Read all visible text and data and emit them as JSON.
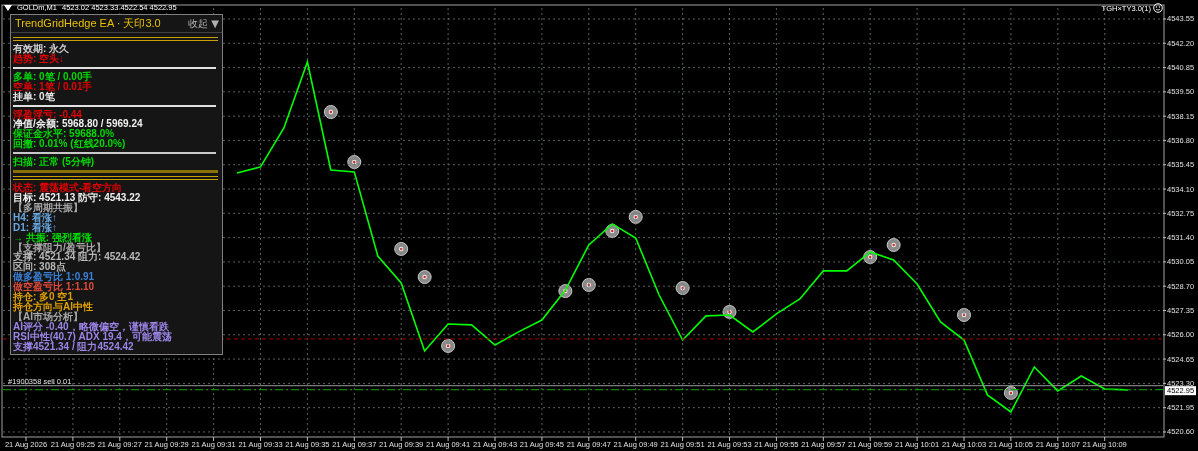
{
  "header": {
    "symbol": "GOLDm,M1",
    "quote": "4523.02 4523.33 4522.54 4522.95",
    "expert": "TGH×TY3.0(1)"
  },
  "panel": {
    "title": "TrendGridHedge EA · 天印3.0",
    "collapse_button": "收起 ▼",
    "lines": [
      {
        "kind": "double_rule",
        "color": "#c8a000"
      },
      {
        "kind": "text",
        "text": "有效期: 永久",
        "color": "#d0d0d0"
      },
      {
        "kind": "text",
        "text": "趋势: 空头↓",
        "color": "#e00000"
      },
      {
        "kind": "rule",
        "color": "#e0e0e0"
      },
      {
        "kind": "text",
        "text": "多单: 0笔 / 0.00手",
        "color": "#00d800"
      },
      {
        "kind": "text",
        "text": "空单: 1笔 / 0.01手",
        "color": "#e00000"
      },
      {
        "kind": "text",
        "text": "挂单: 0笔",
        "color": "#e8e8e8"
      },
      {
        "kind": "rule",
        "color": "#e0e0e0"
      },
      {
        "kind": "text",
        "text": "浮盈浮亏: -0.44",
        "color": "#e00000"
      },
      {
        "kind": "text",
        "text": "净值/余额: 5968.80 / 5969.24",
        "color": "#f0f0f0"
      },
      {
        "kind": "text",
        "text": "保证金水平: 59688.0%",
        "color": "#00d800"
      },
      {
        "kind": "text",
        "text": "回撤: 0.01% (红线20.0%)",
        "color": "#00d800"
      },
      {
        "kind": "rule",
        "color": "#c8c8c8"
      },
      {
        "kind": "text",
        "text": "扫描: 正常 (5分钟)",
        "color": "#00d800"
      },
      {
        "kind": "thick_rule",
        "color": "#8a7000"
      },
      {
        "kind": "double_rule",
        "color": "#c8a000"
      },
      {
        "kind": "text",
        "text": "状态: 震荡模式-看空方向",
        "color": "#e00000"
      },
      {
        "kind": "text",
        "text": "目标: 4521.13  防守: 4543.22",
        "color": "#f0f0f0"
      },
      {
        "kind": "text",
        "text": "【多周期共振】",
        "color": "#a8a8a8"
      },
      {
        "kind": "text",
        "text": "H4: 看涨↑",
        "color": "#68a8e0"
      },
      {
        "kind": "text",
        "text": "D1: 看涨↑",
        "color": "#68a8e0"
      },
      {
        "kind": "text",
        "text": "→ 共振: 强烈看涨",
        "color": "#00e000"
      },
      {
        "kind": "text",
        "text": "【支撑阻力/盈亏比】",
        "color": "#a8a8a8"
      },
      {
        "kind": "text",
        "text": "支撑: 4521.34  阻力: 4524.42",
        "color": "#b8b8b8"
      },
      {
        "kind": "text",
        "text": "区间: 308点",
        "color": "#b8b8b8"
      },
      {
        "kind": "text",
        "text": "做多盈亏比 1:0.91",
        "color": "#3a80d8"
      },
      {
        "kind": "text",
        "text": "做空盈亏比 1:1.10",
        "color": "#e04a3a"
      },
      {
        "kind": "text",
        "text": "持仓: 多0 空1",
        "color": "#e0a000"
      },
      {
        "kind": "text",
        "text": "持仓方向与AI中性",
        "color": "#e0a000"
      },
      {
        "kind": "text",
        "text": "【AI市场分析】",
        "color": "#a8a8a8"
      },
      {
        "kind": "text",
        "text": "AI评分 -0.40，略微偏空，谨慎看跌",
        "color": "#9c84e8"
      },
      {
        "kind": "text",
        "text": "RSI中性(40.7) ADX 19.4，可能震荡",
        "color": "#9c84e8"
      },
      {
        "kind": "text",
        "text": "支撑4521.34 / 阻力4524.42",
        "color": "#9c84e8"
      }
    ]
  },
  "chart": {
    "chart_data": {
      "type": "line",
      "categories": [
        "21 Aug 2026",
        null,
        "21 Aug 09:25",
        null,
        "21 Aug 09:27",
        null,
        "21 Aug 09:29",
        null,
        "21 Aug 09:31",
        null,
        "21 Aug 09:33",
        null,
        "21 Aug 09:35",
        null,
        "21 Aug 09:37",
        null,
        "21 Aug 09:39",
        null,
        "21 Aug 09:41",
        null,
        "21 Aug 09:43",
        null,
        "21 Aug 09:45",
        null,
        "21 Aug 09:47",
        null,
        "21 Aug 09:49",
        null,
        "21 Aug 09:51",
        null,
        "21 Aug 09:53",
        null,
        "21 Aug 09:55",
        null,
        "21 Aug 09:57",
        null,
        "21 Aug 09:59",
        null,
        "21 Aug 10:01",
        null,
        "21 Aug 10:03",
        null,
        "21 Aug 10:05",
        null,
        "21 Aug 10:07",
        null,
        "21 Aug 10:09",
        null,
        null,
        null
      ],
      "series": [
        {
          "color": "#00ff00",
          "values": [
            null,
            null,
            null,
            null,
            null,
            null,
            null,
            null,
            null,
            4534.99,
            4535.33,
            4537.49,
            4541.16,
            4535.16,
            4535.05,
            4530.38,
            4528.88,
            4525.1,
            4526.6,
            4526.55,
            4525.43,
            4526.16,
            4526.82,
            4528.49,
            4530.99,
            4532.16,
            4531.38,
            4528.21,
            4525.71,
            4527.05,
            4527.1,
            4526.16,
            4527.16,
            4527.99,
            4529.55,
            4529.55,
            4530.6,
            4530.16,
            4528.82,
            4526.71,
            4525.71,
            4522.66,
            4521.71,
            4524.21,
            4522.88,
            4523.71,
            4522.99,
            4522.94,
            null,
            null
          ]
        }
      ],
      "ylim": [
        4520.32,
        4544.16
      ],
      "grid": true,
      "yticks": [
        {
          "value": 4543.55,
          "label": "4543.55"
        },
        {
          "value": 4542.2,
          "label": "4542.20"
        },
        {
          "value": 4540.85,
          "label": "4540.85"
        },
        {
          "value": 4539.5,
          "label": "4539.50"
        },
        {
          "value": 4538.15,
          "label": "4538.15"
        },
        {
          "value": 4536.8,
          "label": "4536.80"
        },
        {
          "value": 4535.45,
          "label": "4535.45"
        },
        {
          "value": 4534.1,
          "label": "4534.10"
        },
        {
          "value": 4532.75,
          "label": "4532.75"
        },
        {
          "value": 4531.4,
          "label": "4531.40"
        },
        {
          "value": 4530.05,
          "label": "4530.05"
        },
        {
          "value": 4528.7,
          "label": "4528.70"
        },
        {
          "value": 4527.35,
          "label": "4527.35"
        },
        {
          "value": 4526.0,
          "label": "4526.00"
        },
        {
          "value": 4524.65,
          "label": "4524.65"
        },
        {
          "value": 4523.3,
          "label": "4523.30"
        },
        {
          "value": 4521.95,
          "label": "4521.95"
        },
        {
          "value": 4520.6,
          "label": "4520.60"
        }
      ]
    },
    "order_label": "#1900358 sell 0.01",
    "price_tag": "4522.95"
  }
}
